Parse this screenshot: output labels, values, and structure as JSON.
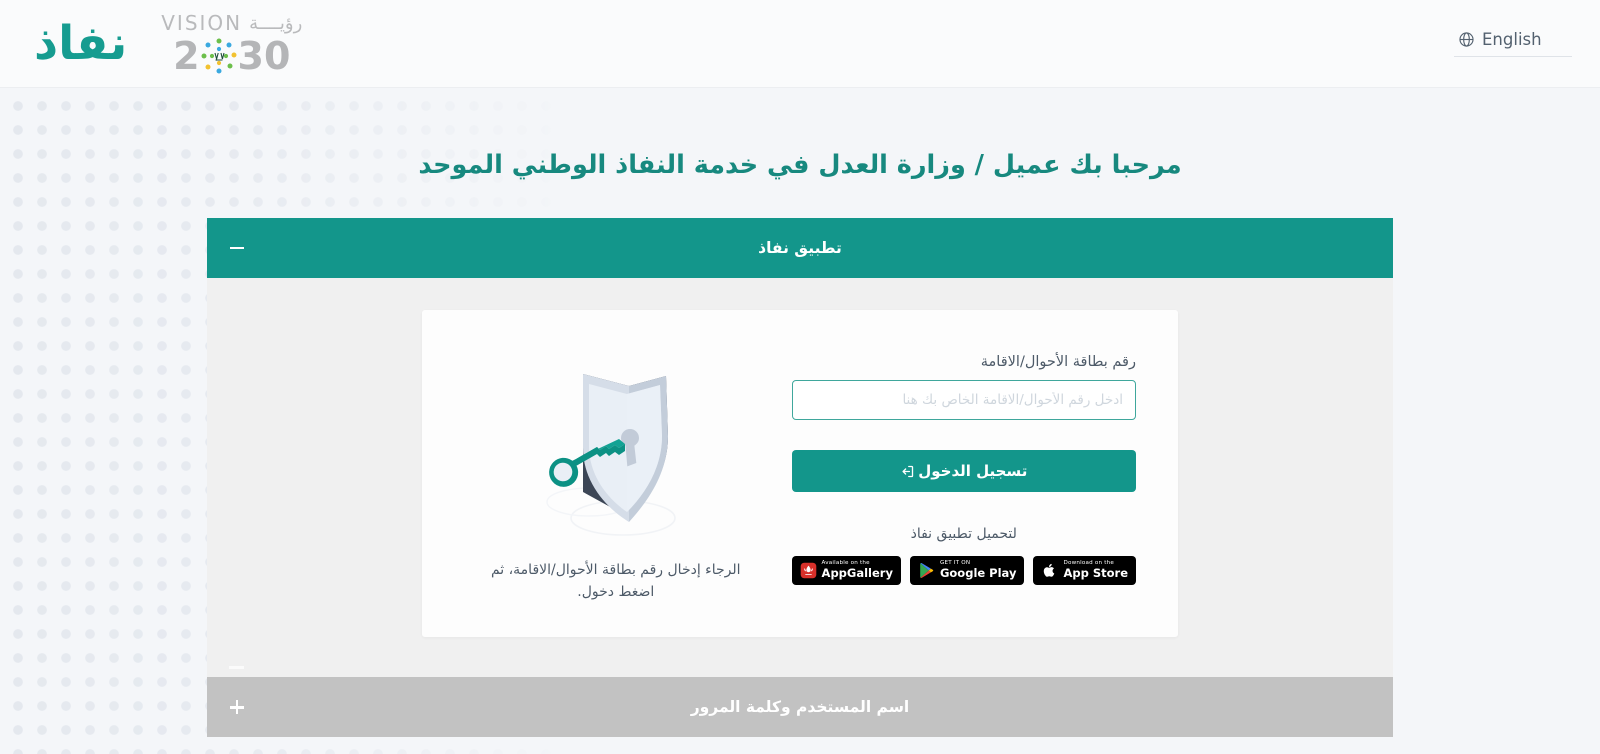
{
  "header": {
    "brand_logo_text": "نفاذ",
    "vision_label_en": "VISION",
    "vision_label_ar": "رؤيــــة",
    "vision_year_left": "2",
    "vision_year_right": "30",
    "language_label": "English",
    "language_icon": "globe-icon"
  },
  "main": {
    "welcome_title": "مرحبا بك عميل / وزارة العدل في خدمة النفاذ الوطني الموحد"
  },
  "accordion_nafath": {
    "title": "تطبيق نفاذ",
    "state": "expanded",
    "toggle_icon": "minus-icon",
    "form": {
      "id_label": "رقم بطاقة الأحوال/الاقامة",
      "id_value": "",
      "id_placeholder": "ادخل رقم الأحوال/الاقامة الخاص بك هنا",
      "login_button": "تسجيل الدخول",
      "login_icon": "sign-in-icon"
    },
    "download": {
      "caption": "لتحميل تطبيق نفاذ",
      "badges": [
        {
          "icon": "huawei-icon",
          "line1": "Available on the",
          "line2": "AppGallery"
        },
        {
          "icon": "google-play-icon",
          "line1": "GET IT ON",
          "line2": "Google Play"
        },
        {
          "icon": "apple-icon",
          "line1": "Download on the",
          "line2": "App Store"
        }
      ]
    },
    "illustration": {
      "icon": "shield-key-icon",
      "hint": "الرجاء إدخال رقم بطاقة الأحوال/الاقامة، ثم اضغط دخول."
    }
  },
  "accordion_credentials": {
    "title": "اسم المستخدم وكلمة المرور",
    "state": "collapsed",
    "toggle_icon": "plus-icon"
  },
  "colors": {
    "teal": "#13968b",
    "teal_title": "#17897f",
    "grey_header": "#c2c2c2",
    "panel_bg": "#f0f0f0",
    "page_bg": "#f4f6f9",
    "card_bg": "#fdfdfd",
    "text": "#4d5a68"
  }
}
